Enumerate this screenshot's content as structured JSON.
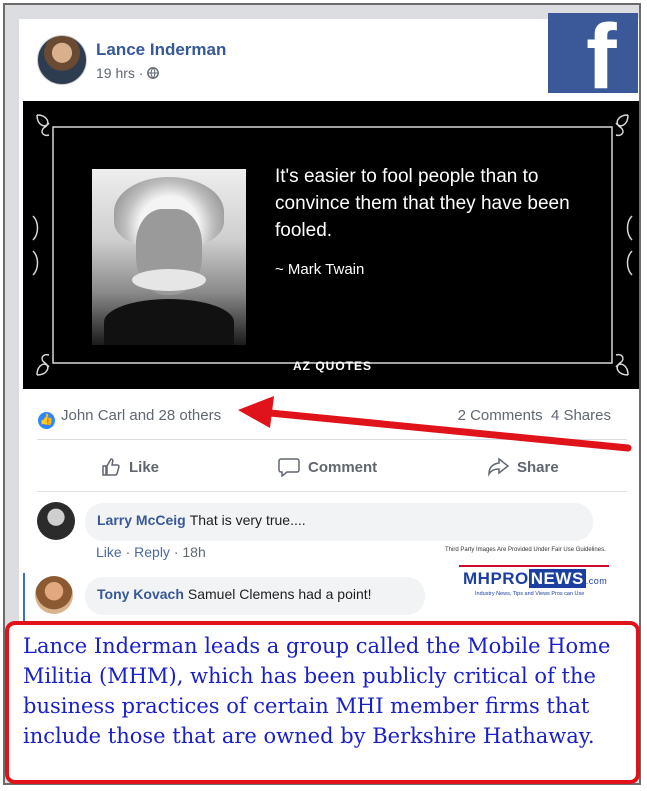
{
  "post": {
    "author": "Lance Inderman",
    "time": "19 hrs · ",
    "privacy_icon": "globe-icon"
  },
  "quote_image": {
    "quote": "It's easier to fool people than to convince them that they have been fooled.",
    "author": "~ Mark Twain",
    "brand": "AZ QUOTES"
  },
  "reactions": {
    "likes": "John Carl and 28 others",
    "comments": "2 Comments",
    "shares": "4 Shares"
  },
  "actions": {
    "like": "Like",
    "comment": "Comment",
    "share": "Share"
  },
  "comments": [
    {
      "author": "Larry McCeig",
      "text": "That is very true....",
      "like": "Like",
      "reply": "Reply",
      "time": "18h"
    },
    {
      "author": "Tony Kovach",
      "text": "Samuel Clemens had a point!"
    }
  ],
  "watermark": {
    "notice": "Third Party Images Are Provided Under Fair Use Guidelines.",
    "logo_mhpro": "MHPRO",
    "logo_news": "NEWS",
    "logo_com": ".com",
    "tagline": "Industry News, Tips and Views Pros can Use"
  },
  "caption": "Lance Inderman leads a group called the Mobile Home Militia (MHM), which has been publicly critical of the business practices of certain MHI member firms that include those that are owned by Berkshire Hathaway.",
  "colors": {
    "facebook": "#3b5998",
    "link": "#365899",
    "arrow": "#e0131a",
    "caption_text": "#1a20c8"
  }
}
